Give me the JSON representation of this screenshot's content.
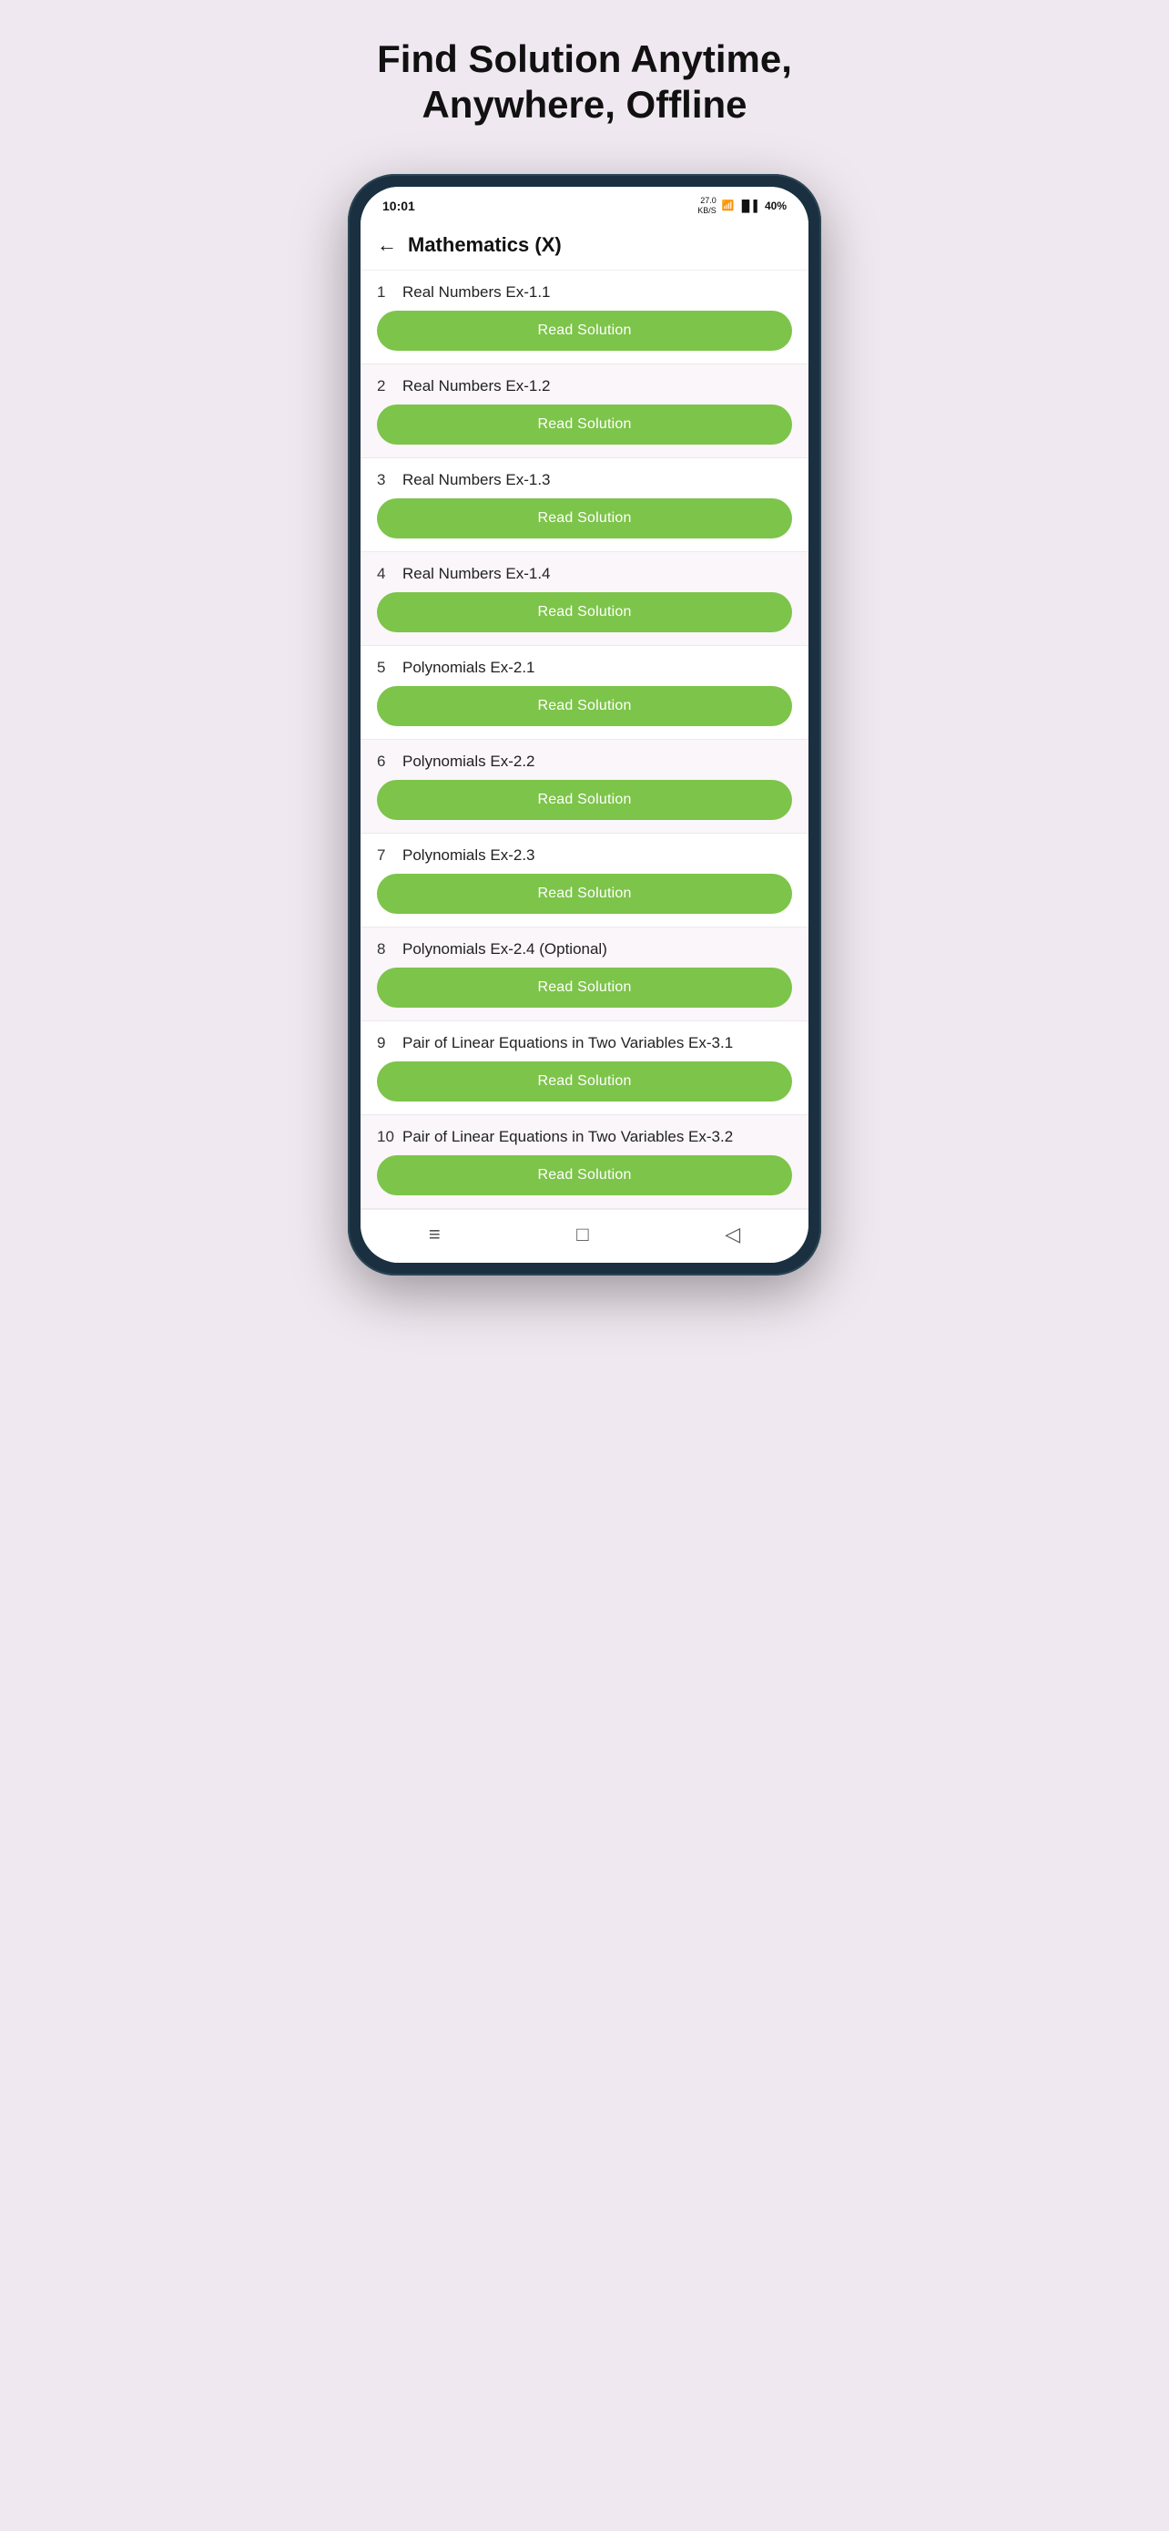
{
  "headline": "Find Solution Anytime, Anywhere, Offline",
  "phone": {
    "status_bar": {
      "time": "10:01",
      "kb_s": "27.0\nKB/S",
      "battery": "40%"
    },
    "header": {
      "title": "Mathematics (X)",
      "back_label": "←"
    },
    "exercises": [
      {
        "number": "1",
        "name": "Real Numbers Ex-1.1",
        "button": "Read Solution"
      },
      {
        "number": "2",
        "name": "Real Numbers Ex-1.2",
        "button": "Read Solution"
      },
      {
        "number": "3",
        "name": "Real Numbers Ex-1.3",
        "button": "Read Solution"
      },
      {
        "number": "4",
        "name": "Real Numbers Ex-1.4",
        "button": "Read Solution"
      },
      {
        "number": "5",
        "name": "Polynomials Ex-2.1",
        "button": "Read Solution"
      },
      {
        "number": "6",
        "name": "Polynomials Ex-2.2",
        "button": "Read Solution"
      },
      {
        "number": "7",
        "name": "Polynomials Ex-2.3",
        "button": "Read Solution"
      },
      {
        "number": "8",
        "name": "Polynomials Ex-2.4 (Optional)",
        "button": "Read Solution"
      },
      {
        "number": "9",
        "name": "Pair of Linear Equations in Two Variables Ex-3.1",
        "button": "Read Solution"
      },
      {
        "number": "10",
        "name": "Pair of Linear Equations in Two Variables Ex-3.2",
        "button": "Read Solution"
      }
    ],
    "nav_icons": [
      "≡",
      "□",
      "◁"
    ],
    "colors": {
      "button_green": "#7dc44a",
      "background_pink": "#f0e8f0"
    }
  }
}
